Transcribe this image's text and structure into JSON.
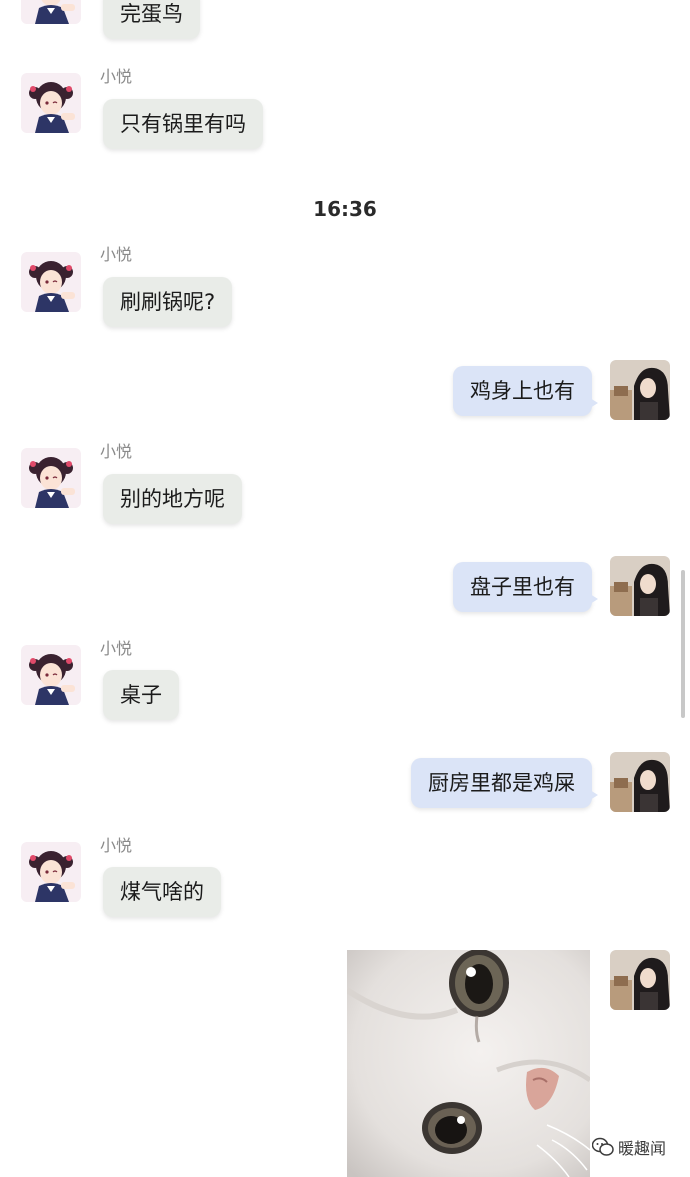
{
  "chat": {
    "time_divider": "16:36",
    "messages": [
      {
        "sender": "",
        "text": "完蛋鸟"
      },
      {
        "sender": "小悦",
        "text": "只有锅里有吗"
      },
      {
        "sender": "小悦",
        "text": "刷刷锅呢?"
      },
      {
        "sender": "me",
        "text": "鸡身上也有"
      },
      {
        "sender": "小悦",
        "text": "别的地方呢"
      },
      {
        "sender": "me",
        "text": "盘子里也有"
      },
      {
        "sender": "小悦",
        "text": "桌子"
      },
      {
        "sender": "me",
        "text": "厨房里都是鸡屎"
      },
      {
        "sender": "小悦",
        "text": "煤气啥的"
      }
    ]
  },
  "watermark": {
    "text": "暖趣闻"
  },
  "icons": {
    "contact_avatar": "anime-girl-avatar-icon",
    "self_avatar": "self-avatar-icon",
    "sticker": "crying-cat-sticker-image",
    "watermark_logo": "wechat-logo-icon"
  }
}
